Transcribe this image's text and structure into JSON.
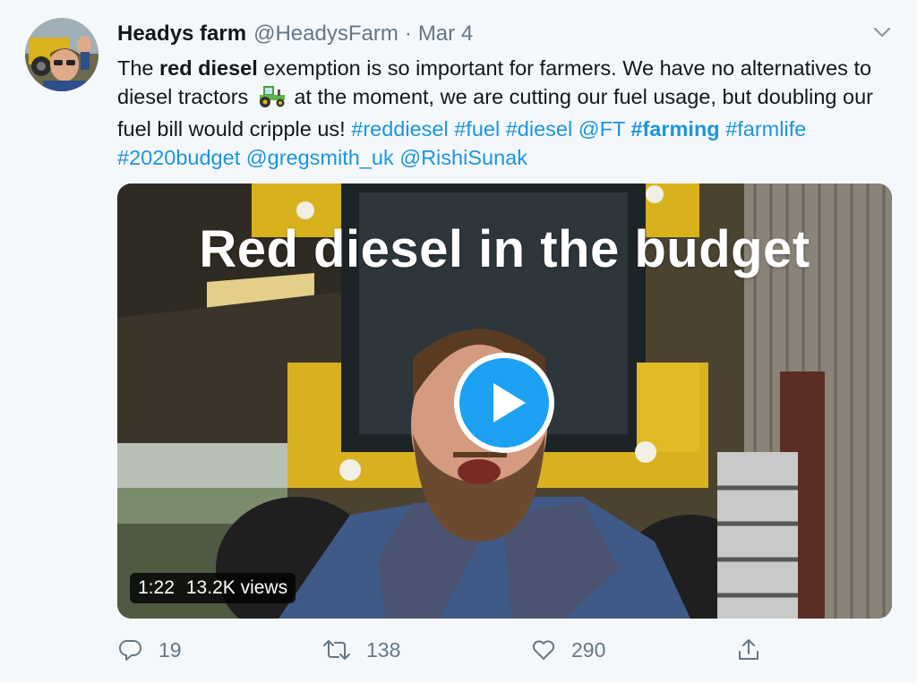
{
  "tweet": {
    "author_name": "Headys farm",
    "handle": "@HeadysFarm",
    "separator": "·",
    "date": "Mar 4",
    "text": {
      "t1": "The ",
      "t2": "red diesel",
      "t3": " exemption is so important for farmers. We have no alternatives to diesel tractors ",
      "t4": " at the moment, we are cutting our fuel usage, but doubling our fuel bill would cripple us! ",
      "h1": "#reddiesel",
      "h2": "#fuel",
      "h3": "#diesel",
      "m1": "@FT",
      "h4": "#farming",
      "h5": "#farmlife",
      "h6": "#2020budget",
      "m2": "@gregsmith_uk",
      "m3": "@RishiSunak",
      "emoji": "tractor"
    }
  },
  "media": {
    "overlay_title": "Red diesel in the budget",
    "duration": "1:22",
    "views": "13.2K views"
  },
  "actions": {
    "reply_count": "19",
    "retweet_count": "138",
    "like_count": "290"
  },
  "icons": {
    "reply": "reply-icon",
    "retweet": "retweet-icon",
    "like": "heart-icon",
    "share": "share-icon",
    "caret": "chevron-down-icon",
    "play": "play-icon"
  },
  "colors": {
    "link": "#1b95e0",
    "play_button": "#1da1f2",
    "secondary_text": "#657786",
    "background": "#f5f8fa"
  }
}
